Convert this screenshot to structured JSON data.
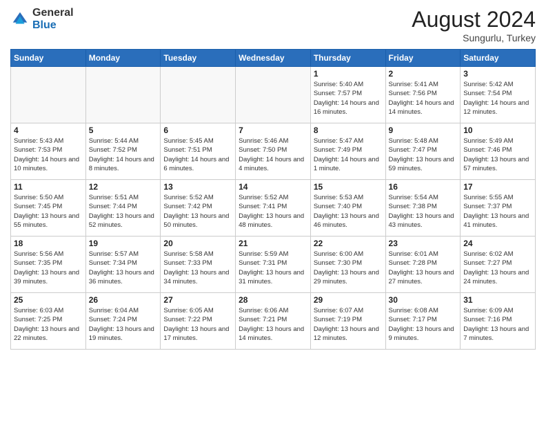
{
  "header": {
    "logo_general": "General",
    "logo_blue": "Blue",
    "month_title": "August 2024",
    "location": "Sungurlu, Turkey"
  },
  "weekdays": [
    "Sunday",
    "Monday",
    "Tuesday",
    "Wednesday",
    "Thursday",
    "Friday",
    "Saturday"
  ],
  "weeks": [
    [
      {
        "day": "",
        "sunrise": "",
        "sunset": "",
        "daylight": ""
      },
      {
        "day": "",
        "sunrise": "",
        "sunset": "",
        "daylight": ""
      },
      {
        "day": "",
        "sunrise": "",
        "sunset": "",
        "daylight": ""
      },
      {
        "day": "",
        "sunrise": "",
        "sunset": "",
        "daylight": ""
      },
      {
        "day": "1",
        "sunrise": "Sunrise: 5:40 AM",
        "sunset": "Sunset: 7:57 PM",
        "daylight": "Daylight: 14 hours and 16 minutes."
      },
      {
        "day": "2",
        "sunrise": "Sunrise: 5:41 AM",
        "sunset": "Sunset: 7:56 PM",
        "daylight": "Daylight: 14 hours and 14 minutes."
      },
      {
        "day": "3",
        "sunrise": "Sunrise: 5:42 AM",
        "sunset": "Sunset: 7:54 PM",
        "daylight": "Daylight: 14 hours and 12 minutes."
      }
    ],
    [
      {
        "day": "4",
        "sunrise": "Sunrise: 5:43 AM",
        "sunset": "Sunset: 7:53 PM",
        "daylight": "Daylight: 14 hours and 10 minutes."
      },
      {
        "day": "5",
        "sunrise": "Sunrise: 5:44 AM",
        "sunset": "Sunset: 7:52 PM",
        "daylight": "Daylight: 14 hours and 8 minutes."
      },
      {
        "day": "6",
        "sunrise": "Sunrise: 5:45 AM",
        "sunset": "Sunset: 7:51 PM",
        "daylight": "Daylight: 14 hours and 6 minutes."
      },
      {
        "day": "7",
        "sunrise": "Sunrise: 5:46 AM",
        "sunset": "Sunset: 7:50 PM",
        "daylight": "Daylight: 14 hours and 4 minutes."
      },
      {
        "day": "8",
        "sunrise": "Sunrise: 5:47 AM",
        "sunset": "Sunset: 7:49 PM",
        "daylight": "Daylight: 14 hours and 1 minute."
      },
      {
        "day": "9",
        "sunrise": "Sunrise: 5:48 AM",
        "sunset": "Sunset: 7:47 PM",
        "daylight": "Daylight: 13 hours and 59 minutes."
      },
      {
        "day": "10",
        "sunrise": "Sunrise: 5:49 AM",
        "sunset": "Sunset: 7:46 PM",
        "daylight": "Daylight: 13 hours and 57 minutes."
      }
    ],
    [
      {
        "day": "11",
        "sunrise": "Sunrise: 5:50 AM",
        "sunset": "Sunset: 7:45 PM",
        "daylight": "Daylight: 13 hours and 55 minutes."
      },
      {
        "day": "12",
        "sunrise": "Sunrise: 5:51 AM",
        "sunset": "Sunset: 7:44 PM",
        "daylight": "Daylight: 13 hours and 52 minutes."
      },
      {
        "day": "13",
        "sunrise": "Sunrise: 5:52 AM",
        "sunset": "Sunset: 7:42 PM",
        "daylight": "Daylight: 13 hours and 50 minutes."
      },
      {
        "day": "14",
        "sunrise": "Sunrise: 5:52 AM",
        "sunset": "Sunset: 7:41 PM",
        "daylight": "Daylight: 13 hours and 48 minutes."
      },
      {
        "day": "15",
        "sunrise": "Sunrise: 5:53 AM",
        "sunset": "Sunset: 7:40 PM",
        "daylight": "Daylight: 13 hours and 46 minutes."
      },
      {
        "day": "16",
        "sunrise": "Sunrise: 5:54 AM",
        "sunset": "Sunset: 7:38 PM",
        "daylight": "Daylight: 13 hours and 43 minutes."
      },
      {
        "day": "17",
        "sunrise": "Sunrise: 5:55 AM",
        "sunset": "Sunset: 7:37 PM",
        "daylight": "Daylight: 13 hours and 41 minutes."
      }
    ],
    [
      {
        "day": "18",
        "sunrise": "Sunrise: 5:56 AM",
        "sunset": "Sunset: 7:35 PM",
        "daylight": "Daylight: 13 hours and 39 minutes."
      },
      {
        "day": "19",
        "sunrise": "Sunrise: 5:57 AM",
        "sunset": "Sunset: 7:34 PM",
        "daylight": "Daylight: 13 hours and 36 minutes."
      },
      {
        "day": "20",
        "sunrise": "Sunrise: 5:58 AM",
        "sunset": "Sunset: 7:33 PM",
        "daylight": "Daylight: 13 hours and 34 minutes."
      },
      {
        "day": "21",
        "sunrise": "Sunrise: 5:59 AM",
        "sunset": "Sunset: 7:31 PM",
        "daylight": "Daylight: 13 hours and 31 minutes."
      },
      {
        "day": "22",
        "sunrise": "Sunrise: 6:00 AM",
        "sunset": "Sunset: 7:30 PM",
        "daylight": "Daylight: 13 hours and 29 minutes."
      },
      {
        "day": "23",
        "sunrise": "Sunrise: 6:01 AM",
        "sunset": "Sunset: 7:28 PM",
        "daylight": "Daylight: 13 hours and 27 minutes."
      },
      {
        "day": "24",
        "sunrise": "Sunrise: 6:02 AM",
        "sunset": "Sunset: 7:27 PM",
        "daylight": "Daylight: 13 hours and 24 minutes."
      }
    ],
    [
      {
        "day": "25",
        "sunrise": "Sunrise: 6:03 AM",
        "sunset": "Sunset: 7:25 PM",
        "daylight": "Daylight: 13 hours and 22 minutes."
      },
      {
        "day": "26",
        "sunrise": "Sunrise: 6:04 AM",
        "sunset": "Sunset: 7:24 PM",
        "daylight": "Daylight: 13 hours and 19 minutes."
      },
      {
        "day": "27",
        "sunrise": "Sunrise: 6:05 AM",
        "sunset": "Sunset: 7:22 PM",
        "daylight": "Daylight: 13 hours and 17 minutes."
      },
      {
        "day": "28",
        "sunrise": "Sunrise: 6:06 AM",
        "sunset": "Sunset: 7:21 PM",
        "daylight": "Daylight: 13 hours and 14 minutes."
      },
      {
        "day": "29",
        "sunrise": "Sunrise: 6:07 AM",
        "sunset": "Sunset: 7:19 PM",
        "daylight": "Daylight: 13 hours and 12 minutes."
      },
      {
        "day": "30",
        "sunrise": "Sunrise: 6:08 AM",
        "sunset": "Sunset: 7:17 PM",
        "daylight": "Daylight: 13 hours and 9 minutes."
      },
      {
        "day": "31",
        "sunrise": "Sunrise: 6:09 AM",
        "sunset": "Sunset: 7:16 PM",
        "daylight": "Daylight: 13 hours and 7 minutes."
      }
    ]
  ]
}
